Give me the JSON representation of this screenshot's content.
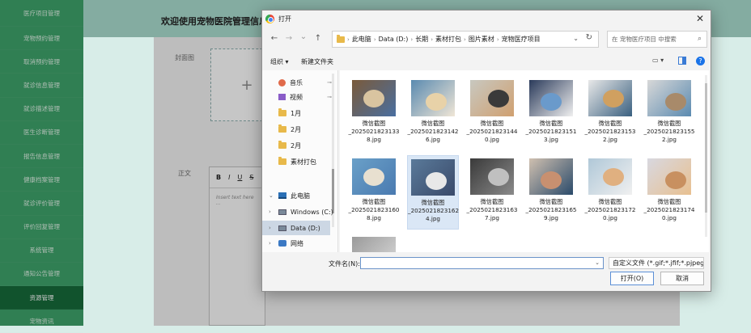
{
  "sidebar": {
    "items": [
      "医疗项目管理",
      "宠物预约管理",
      "取消预约管理",
      "就诊信息管理",
      "就诊描述管理",
      "医生诊断管理",
      "报告信息管理",
      "健康档案管理",
      "就诊评价管理",
      "评价回复管理",
      "系统管理",
      "通知公告管理",
      "资源管理",
      "宠物资讯"
    ],
    "active_index": 12
  },
  "header": {
    "title": "欢迎使用宠物医院管理信息系统"
  },
  "form": {
    "cover_label": "封面图",
    "content_label": "正文",
    "add_symbol": "+",
    "editor": {
      "bold": "B",
      "italic": "I",
      "underline": "U",
      "strike": "S",
      "placeholder": "Insert text here ..."
    }
  },
  "dialog": {
    "title": "打开",
    "close": "✕",
    "nav": {
      "back": "←",
      "forward": "→",
      "dropdown": "⌄",
      "up": "↑"
    },
    "breadcrumb": [
      "此电脑",
      "Data (D:)",
      "长期",
      "素材打包",
      "图片素材",
      "宠物医疗项目"
    ],
    "search_placeholder": "在 宠物医疗项目 中搜索",
    "toolbar": {
      "organize": "组织 ▾",
      "new_folder": "新建文件夹",
      "view": "▭ ▾",
      "help": "?"
    },
    "nav_pane": [
      {
        "label": "音乐",
        "icon": "music-icon",
        "pinned": true
      },
      {
        "label": "视频",
        "icon": "video-icon",
        "pinned": true
      },
      {
        "label": "1月",
        "icon": "folder-icon"
      },
      {
        "label": "2月",
        "icon": "folder-icon"
      },
      {
        "label": "2月",
        "icon": "folder-icon"
      },
      {
        "label": "素材打包",
        "icon": "folder-icon"
      },
      {
        "label": "此电脑",
        "icon": "pc-icon",
        "expanded": true
      },
      {
        "label": "Windows (C:)",
        "icon": "drive-icon"
      },
      {
        "label": "Data (D:)",
        "icon": "drive-icon",
        "selected": true
      },
      {
        "label": "网络",
        "icon": "network-icon"
      }
    ],
    "files": [
      {
        "name1": "微信截图",
        "name2": "_2025021823133",
        "name3": "8.jpg"
      },
      {
        "name1": "微信截图",
        "name2": "_2025021823142",
        "name3": "6.jpg"
      },
      {
        "name1": "微信截图",
        "name2": "_2025021823144",
        "name3": "0.jpg"
      },
      {
        "name1": "微信截图",
        "name2": "_2025021823151",
        "name3": "3.jpg"
      },
      {
        "name1": "微信截图",
        "name2": "_2025021823153",
        "name3": "2.jpg"
      },
      {
        "name1": "微信截图",
        "name2": "_2025021823155",
        "name3": "2.jpg"
      },
      {
        "name1": "微信截图",
        "name2": "_2025021823160",
        "name3": "8.jpg"
      },
      {
        "name1": "微信截图",
        "name2": "_2025021823162",
        "name3": "4.jpg"
      },
      {
        "name1": "微信截图",
        "name2": "_2025021823163",
        "name3": "7.jpg"
      },
      {
        "name1": "微信截图",
        "name2": "_2025021823165",
        "name3": "9.jpg"
      },
      {
        "name1": "微信截图",
        "name2": "_2025021823172",
        "name3": "0.jpg"
      },
      {
        "name1": "微信截图",
        "name2": "_2025021823174",
        "name3": "0.jpg"
      }
    ],
    "selected_file_index": 7,
    "filename_label": "文件名(N):",
    "filename_value": "",
    "filetype": "自定义文件 (*.gif;*.jfif;*.pjpeg;",
    "open_button": "打开(O)",
    "cancel_button": "取消"
  }
}
